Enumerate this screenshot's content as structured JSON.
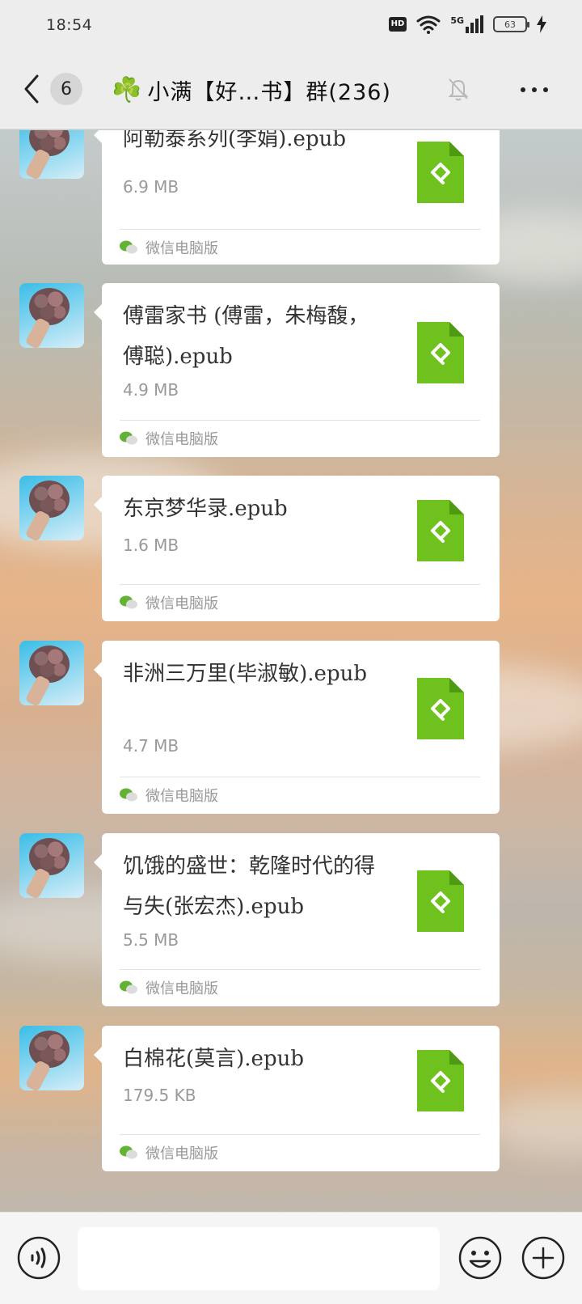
{
  "status_bar": {
    "time": "18:54",
    "hd": "HD",
    "network": "5G",
    "battery": "63"
  },
  "header": {
    "back_icon": "chevron-left-icon",
    "unread_count": "6",
    "group_emoji": "☘️",
    "title": "小满【好…书】群(236)",
    "mute_icon": "bell-off-icon",
    "more_icon": "more-icon"
  },
  "messages": [
    {
      "file_name": "阿勒泰系列(李娟).epub",
      "size": "6.9 MB",
      "source": "微信电脑版"
    },
    {
      "file_name": "傅雷家书 (傅雷，朱梅馥，傅聪).epub",
      "size": "4.9 MB",
      "source": "微信电脑版"
    },
    {
      "file_name": "东京梦华录.epub",
      "size": "1.6 MB",
      "source": "微信电脑版"
    },
    {
      "file_name": "非洲三万里(毕淑敏).epub",
      "size": "4.7 MB",
      "source": "微信电脑版"
    },
    {
      "file_name": "饥饿的盛世：乾隆时代的得与失(张宏杰).epub",
      "size": "5.5 MB",
      "source": "微信电脑版"
    },
    {
      "file_name": "白棉花(莫言).epub",
      "size": "179.5 KB",
      "source": "微信电脑版"
    }
  ],
  "colors": {
    "file_icon_green": "#6fc21e",
    "wechat_green": "#62b233"
  },
  "input_bar": {
    "voice_icon": "voice-icon",
    "emoji_icon": "emoji-icon",
    "plus_icon": "plus-circle-icon",
    "text_value": ""
  }
}
